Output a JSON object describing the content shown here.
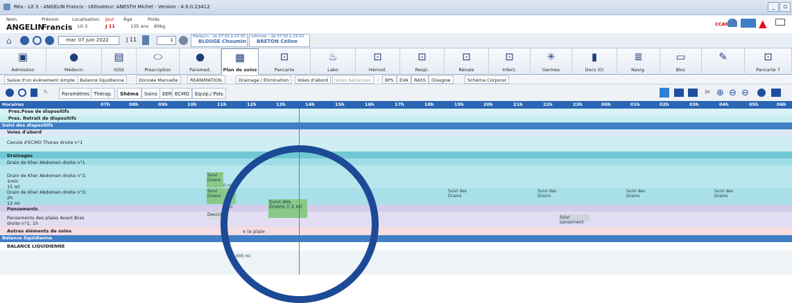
{
  "window": {
    "title": "Réa - Lit 3 - ANGELIN Francis - Utilisateur: ANESTH Michel - Version : 4.9.0.23412"
  },
  "patient": {
    "nom_label": "Nom",
    "prenom_label": "Prénom",
    "nom": "ANGELIN",
    "prenom": "Francis",
    "loc_label": "Localisation:",
    "loc": "Lit 3",
    "jour_label": "Jour",
    "jour": "J 11",
    "age_label": "Âge",
    "age": "135 ans",
    "poids_label": "Poids",
    "poids": "80kg",
    "ccam": "CCAM"
  },
  "nav": {
    "date": "mar. 07 juin 2022",
    "day": "J 11",
    "count": "1",
    "medecin_label": "Médecin - de 07:00 à 07:00",
    "medecin": "BLOUGE Choumin",
    "infirmier_label": "Infirmier - de 07:00 à 19:00",
    "infirmier": "BRETON Céline"
  },
  "modules": [
    "Admission",
    "Médecin",
    "IGSII",
    "Prescription",
    "Paramed.",
    "Plan de soins",
    "Pancarte",
    "Labo",
    "Hémod.",
    "Respi.",
    "Rénale",
    "Infect.",
    "Germes",
    "Docs (0)",
    "Navig.",
    "Bloc",
    "Pancarte 7"
  ],
  "toolbar": [
    "Saisie d'un événement simple",
    "Balance liquidienne",
    "Donnée Manuelle",
    "REANIMATION.",
    "Drainage / Elimination",
    "Voies d'abord",
    "Voies Aériennes",
    "BPS",
    "EVA",
    "RASS",
    "Glasgow",
    "Schéma Corporel"
  ],
  "tabs": [
    "Paramètres",
    "Thérap.",
    "Shéma",
    "Soins",
    "EER",
    "ECMO",
    "Equip./ Psts"
  ],
  "hours_label": "Horaires",
  "hours": [
    "07h",
    "08h",
    "09h",
    "10h",
    "11h",
    "12h",
    "13h",
    "14h",
    "15h",
    "16h",
    "17h",
    "18h",
    "19h",
    "20h",
    "21h",
    "22h",
    "23h",
    "00h",
    "01h",
    "02h",
    "03h",
    "04h",
    "05h",
    "06h"
  ],
  "rows": {
    "r1": "Pres.Pose de dispositifs",
    "r2": "Pres. Retrait de dispositifs",
    "r3": "Suivi des dispositifs",
    "r4": "Voies d'abord",
    "r5": "Canule d'ECMO Thorax droite n°1",
    "r6": "Drainages",
    "r7": "Drain de Kher Abdomen droite n°1",
    "r8a": "Drain de Kher Abdomen droite n°2;",
    "r8b": "1min",
    "r8c": "15 ml",
    "r9a": "Drain de Kher Abdomen droite n°3;",
    "r9b": "2h",
    "r9c": "12 ml",
    "r10": "Pansements",
    "r11a": "Pansements des plaies Avant Bras",
    "r11b": "droite n°1; 1h",
    "r12": "Autres éléments de soins",
    "r13": "Balance liquidienne",
    "r14": "BALANCE LIQUIDIENNE"
  },
  "cells": {
    "suivi": "Suivi",
    "drains": "Drains",
    "suivi_drains": "Suivi des",
    "suivi_drains2": "Drains",
    "zoom_event": "Suivi des Drains // 2 ml",
    "ml": "0 ml",
    "desc": "Descrip",
    "plaie": "e la plaie",
    "pansement": "Suivi pansement:",
    "small": "000 ml"
  }
}
